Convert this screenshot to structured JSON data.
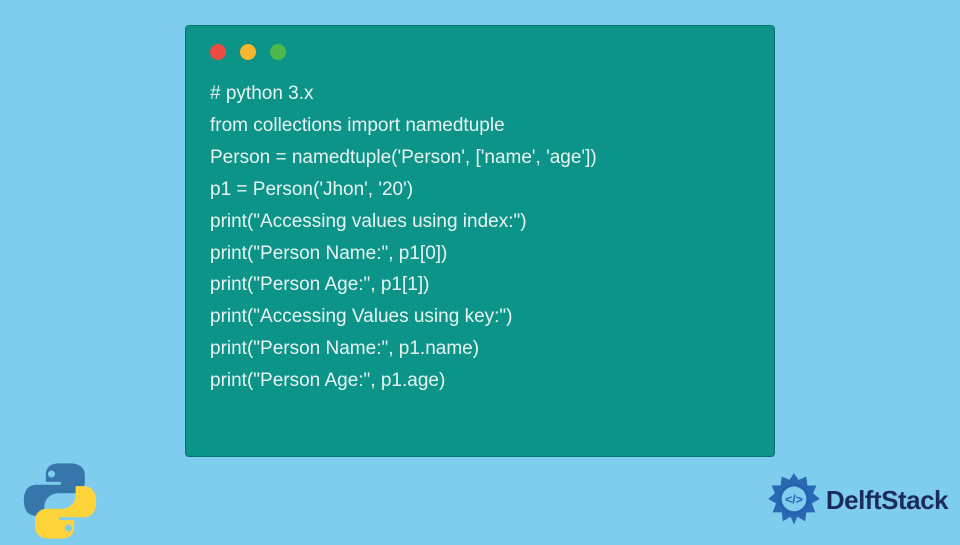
{
  "code": {
    "lines": [
      "# python 3.x",
      "from collections import namedtuple",
      "Person = namedtuple('Person', ['name', 'age'])",
      "p1 = Person('Jhon', '20')",
      "print(\"Accessing values using index:\")",
      "print(\"Person Name:\", p1[0])",
      "print(\"Person Age:\", p1[1])",
      "print(\"Accessing Values using key:\")",
      "print(\"Person Name:\", p1.name)",
      "print(\"Person Age:\", p1.age)"
    ]
  },
  "brand": {
    "name": "DelftStack"
  },
  "colors": {
    "background": "#7fcdee",
    "window": "#0d9488",
    "codeText": "#e8f4f2",
    "brandText": "#1a2b5c",
    "brandIcon": "#2563b0"
  }
}
